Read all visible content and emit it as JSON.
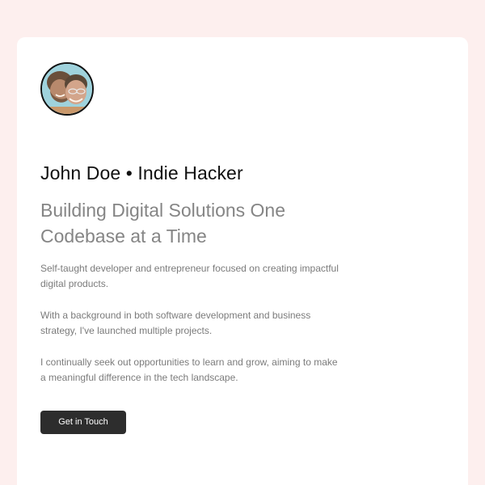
{
  "profile": {
    "avatar_alt": "Two smiling men close together",
    "name_title": "John Doe • Indie Hacker",
    "headline": "Building Digital Solutions One Codebase at a Time",
    "paragraphs": [
      "Self-taught developer and entrepreneur focused on creating impactful digital products.",
      "With a background in both software development and business strategy, I've launched multiple projects.",
      "I continually seek out opportunities to learn and grow, aiming to make a meaningful difference in the tech landscape."
    ],
    "cta_label": "Get in Touch"
  },
  "colors": {
    "page_background": "#fdefee",
    "card_background": "#ffffff",
    "text_primary": "#111111",
    "text_secondary": "#858585",
    "button_background": "#2d2d2d",
    "button_text": "#ffffff"
  }
}
